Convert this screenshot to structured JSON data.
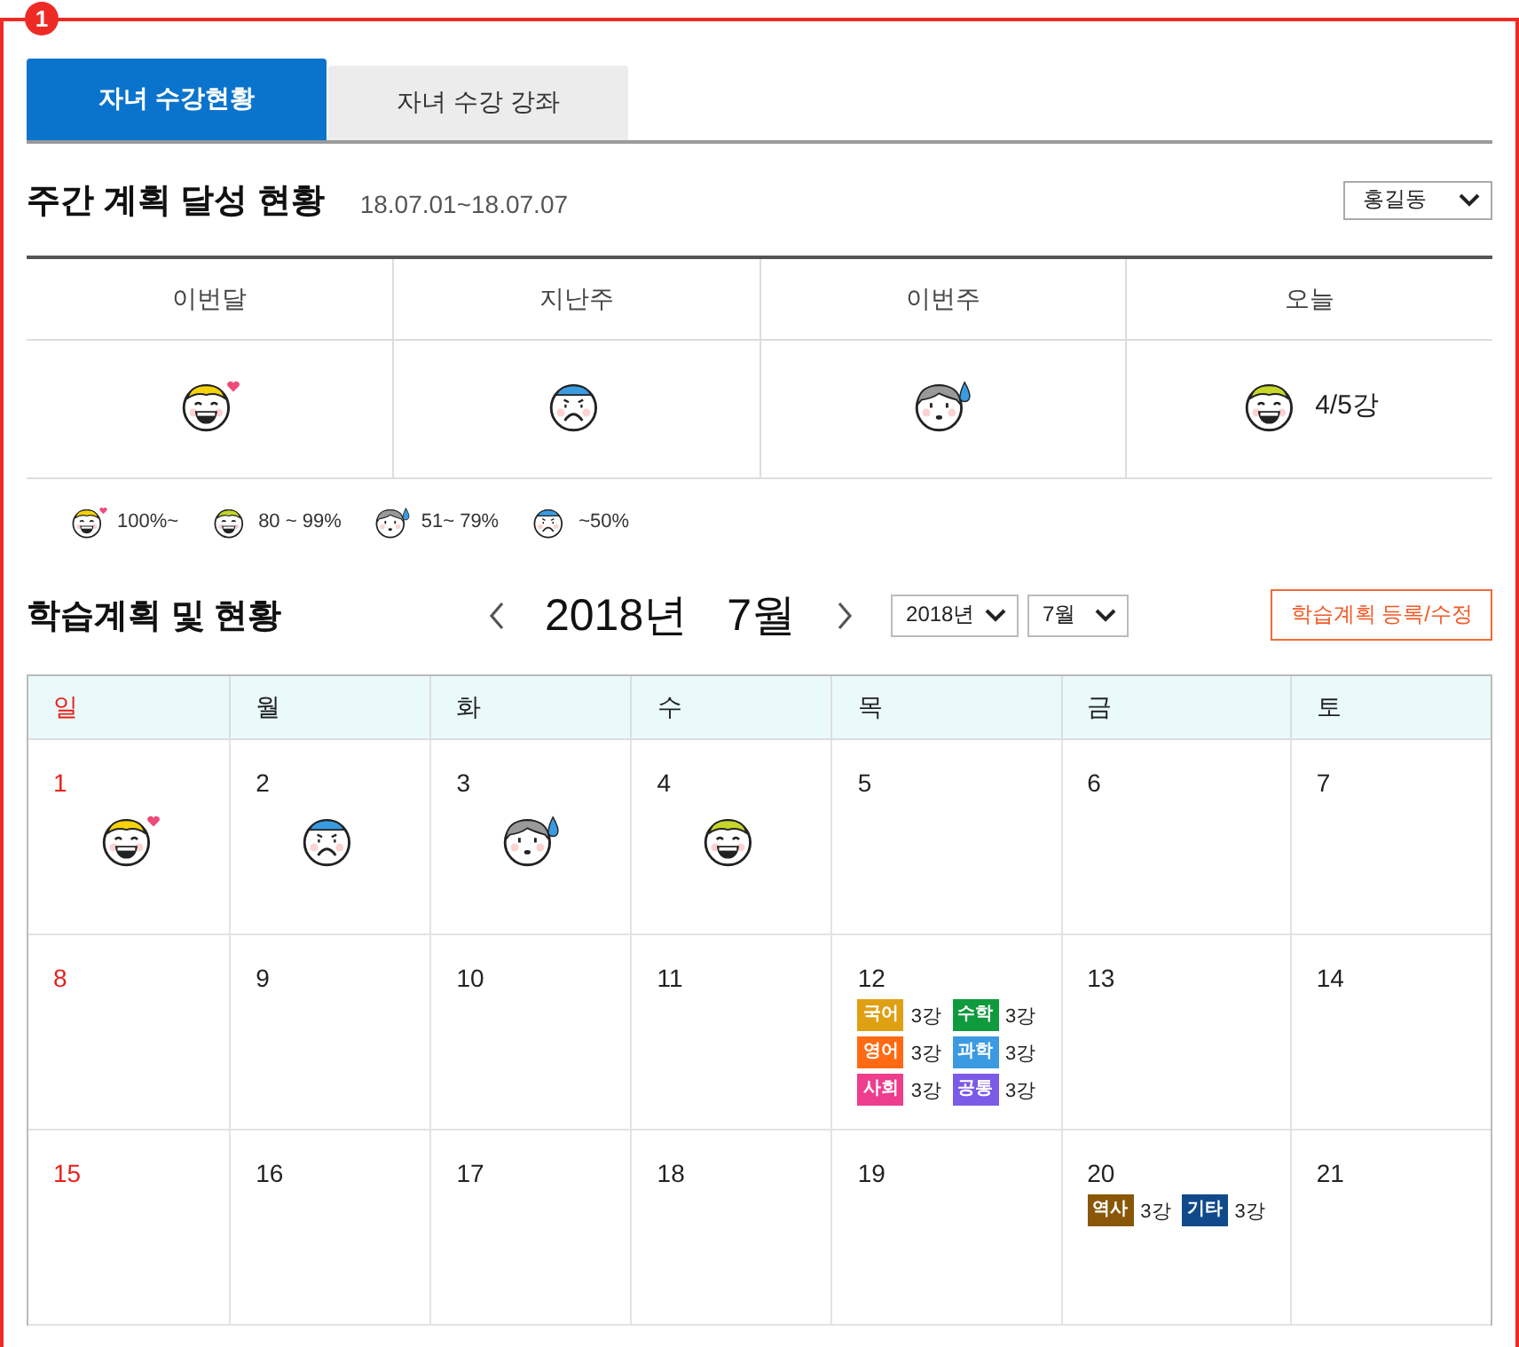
{
  "annotation": {
    "badge": "1"
  },
  "tabs": [
    {
      "label": "자녀 수강현황",
      "selected": true
    },
    {
      "label": "자녀 수강 강좌",
      "selected": false
    }
  ],
  "weekly": {
    "title": "주간 계획 달성 현황",
    "period": "18.07.01~18.07.07",
    "student_select": {
      "value": "홍길동"
    },
    "columns": [
      {
        "label": "이번달",
        "kind": "love"
      },
      {
        "label": "지난주",
        "kind": "angry"
      },
      {
        "label": "이번주",
        "kind": "sweat"
      },
      {
        "label": "오늘",
        "kind": "happy",
        "count": "4/5강"
      }
    ]
  },
  "legend": [
    {
      "kind": "love",
      "label": "100%~"
    },
    {
      "kind": "happy",
      "label": "80 ~ 99%"
    },
    {
      "kind": "sweat",
      "label": "51~ 79%"
    },
    {
      "kind": "angry",
      "label": "~50%"
    }
  ],
  "calendar": {
    "title": "학습계획 및 현황",
    "year": "2018년",
    "month": "7월",
    "year_select": {
      "value": "2018년"
    },
    "month_select": {
      "value": "7월"
    },
    "edit_button": "학습계획 등록/수정",
    "weekdays": [
      "일",
      "월",
      "화",
      "수",
      "목",
      "금",
      "토"
    ],
    "weeks": [
      [
        {
          "day": "1",
          "kind": "love"
        },
        {
          "day": "2",
          "kind": "angry"
        },
        {
          "day": "3",
          "kind": "sweat"
        },
        {
          "day": "4",
          "kind": "happy"
        },
        {
          "day": "5"
        },
        {
          "day": "6"
        },
        {
          "day": "7"
        }
      ],
      [
        {
          "day": "8"
        },
        {
          "day": "9"
        },
        {
          "day": "10"
        },
        {
          "day": "11"
        },
        {
          "day": "12",
          "lessons": [
            {
              "subject": "국어",
              "count": "3강",
              "color": "#e0a014"
            },
            {
              "subject": "수학",
              "count": "3강",
              "color": "#109a3e"
            },
            {
              "subject": "영어",
              "count": "3강",
              "color": "#ff6a13"
            },
            {
              "subject": "과학",
              "count": "3강",
              "color": "#3b9ae1"
            },
            {
              "subject": "사회",
              "count": "3강",
              "color": "#ef3d8d"
            },
            {
              "subject": "공통",
              "count": "3강",
              "color": "#7a5ae6"
            }
          ]
        },
        {
          "day": "13"
        },
        {
          "day": "14"
        }
      ],
      [
        {
          "day": "15"
        },
        {
          "day": "16"
        },
        {
          "day": "17"
        },
        {
          "day": "18"
        },
        {
          "day": "19"
        },
        {
          "day": "20",
          "lessons": [
            {
              "subject": "역사",
              "count": "3강",
              "color": "#8a5608"
            },
            {
              "subject": "기타",
              "count": "3강",
              "color": "#114a8a"
            }
          ]
        },
        {
          "day": "21"
        }
      ]
    ]
  }
}
